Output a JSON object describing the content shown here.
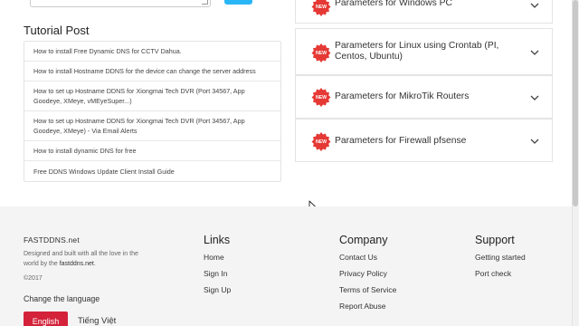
{
  "tutorial": {
    "title": "Tutorial Post",
    "items": [
      {
        "label": "How to install Free Dynamic DNS for CCTV Dahua."
      },
      {
        "label": "How to install Hostname DDNS for the device can change the server address"
      },
      {
        "label": "How to set up Hostname DDNS for Xiongmai Tech DVR (Port 34567, App Goodeye, XMeye, vMEyeSuper...)"
      },
      {
        "label": "How to set up Hostname DDNS for Xiongmai Tech DVR (Port 34567, App Goodeye, XMeye) - Via Email Alerts"
      },
      {
        "label": "How to install dynamic DNS for free"
      },
      {
        "label": "Free DDNS Windows Update Client Install Guide"
      }
    ]
  },
  "parameters": {
    "badge_text": "NEW",
    "badge_color": "#e53935",
    "items": [
      {
        "label": "Parameters for Windows PC"
      },
      {
        "label": "Parameters for Linux using Crontab (PI, Centos, Ubuntu)"
      },
      {
        "label": "Parameters for MikroTik Routers"
      },
      {
        "label": "Parameters for Firewall pfsense"
      }
    ]
  },
  "footer": {
    "brand": "FASTDDNS.net",
    "desc_prefix": "Designed and built with all the love in the world by the ",
    "desc_link": "fastddns.net",
    "desc_suffix": ".",
    "copyright": "©2017",
    "change_language": "Change the language",
    "languages": {
      "english": "English",
      "vietnamese": "Tiếng Việt"
    },
    "accent_color": "#d3223a",
    "links": {
      "title": "Links",
      "items": [
        "Home",
        "Sign In",
        "Sign Up"
      ]
    },
    "company": {
      "title": "Company",
      "items": [
        "Contact Us",
        "Privacy Policy",
        "Terms of Service",
        "Report Abuse"
      ]
    },
    "support": {
      "title": "Support",
      "items": [
        "Getting started",
        "Port check"
      ]
    }
  }
}
